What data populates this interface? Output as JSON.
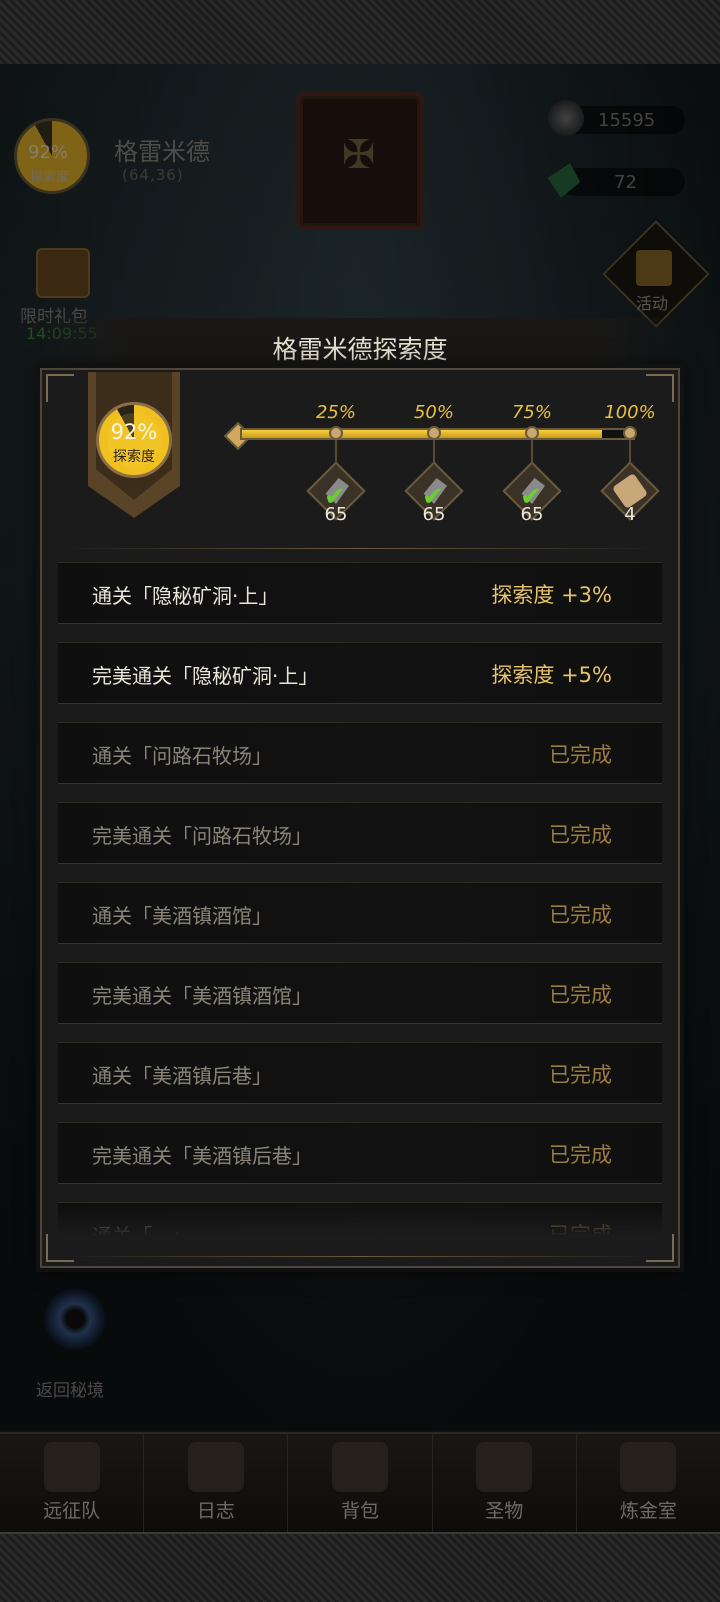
{
  "location": {
    "name": "格雷米德",
    "coords": "(64,36)",
    "explore_pct": "92%",
    "explore_label": "探索度"
  },
  "resources": [
    {
      "icon": "stone-icon",
      "value": "15595"
    },
    {
      "icon": "gem-icon",
      "value": "72"
    }
  ],
  "gift": {
    "label": "限时礼包",
    "timer": "14:09:55"
  },
  "activity": {
    "label": "活动"
  },
  "portal": {
    "label": "返回秘境"
  },
  "modal": {
    "title": "格雷米德探索度",
    "explore_pct": "92%",
    "explore_label": "探索度",
    "progress": 0.92,
    "milestones": [
      {
        "pct": "25%",
        "count": "65",
        "claimed": true
      },
      {
        "pct": "50%",
        "count": "65",
        "claimed": true
      },
      {
        "pct": "75%",
        "count": "65",
        "claimed": true
      },
      {
        "pct": "100%",
        "count": "4",
        "claimed": false
      }
    ],
    "tasks": [
      {
        "label": "通关「隐秘矿洞·上」",
        "status": "探索度 +3%",
        "done": false
      },
      {
        "label": "完美通关「隐秘矿洞·上」",
        "status": "探索度 +5%",
        "done": false
      },
      {
        "label": "通关「问路石牧场」",
        "status": "已完成",
        "done": true
      },
      {
        "label": "完美通关「问路石牧场」",
        "status": "已完成",
        "done": true
      },
      {
        "label": "通关「美酒镇酒馆」",
        "status": "已完成",
        "done": true
      },
      {
        "label": "完美通关「美酒镇酒馆」",
        "status": "已完成",
        "done": true
      },
      {
        "label": "通关「美酒镇后巷」",
        "status": "已完成",
        "done": true
      },
      {
        "label": "完美通关「美酒镇后巷」",
        "status": "已完成",
        "done": true
      },
      {
        "label": "通关「...」",
        "status": "已完成",
        "done": true
      }
    ]
  },
  "nav": [
    {
      "label": "远征队",
      "icon": "helmet-icon"
    },
    {
      "label": "日志",
      "icon": "scroll-icon"
    },
    {
      "label": "背包",
      "icon": "backpack-icon"
    },
    {
      "label": "圣物",
      "icon": "chalice-icon"
    },
    {
      "label": "炼金室",
      "icon": "alchemy-icon"
    }
  ]
}
